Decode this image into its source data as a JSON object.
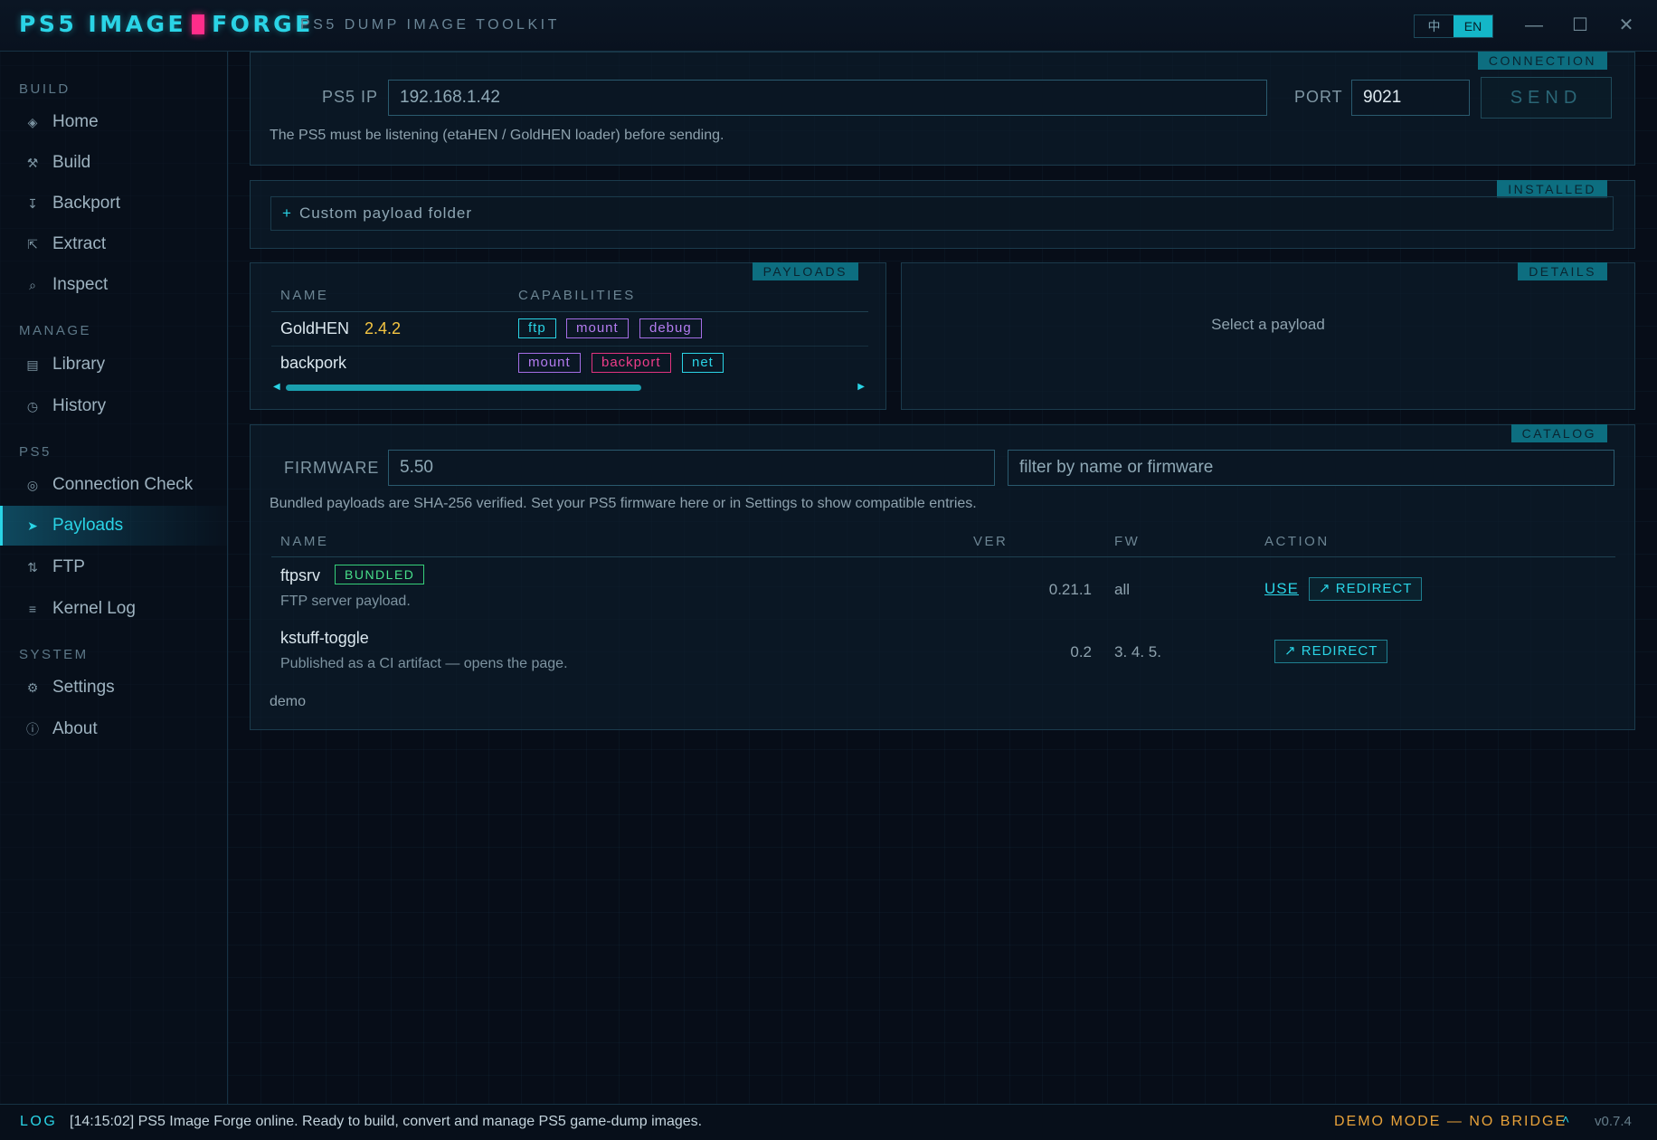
{
  "app": {
    "brand_left": "PS5 IMAGE",
    "brand_right": "FORGE",
    "subtitle": "PS5 DUMP IMAGE TOOLKIT",
    "lang_options": [
      "中",
      "EN"
    ],
    "active_lang": "EN",
    "window_controls": {
      "minimize": "—",
      "maximize": "☐",
      "close": "✕"
    }
  },
  "sidebar": {
    "sections": [
      {
        "label": "BUILD",
        "items": [
          {
            "icon": "home-icon",
            "glyph": "◈",
            "label": "Home"
          },
          {
            "icon": "build-icon",
            "glyph": "⚒",
            "label": "Build"
          },
          {
            "icon": "backport-icon",
            "glyph": "↧",
            "label": "Backport"
          },
          {
            "icon": "extract-icon",
            "glyph": "⇱",
            "label": "Extract"
          },
          {
            "icon": "inspect-icon",
            "glyph": "⌕",
            "label": "Inspect"
          }
        ]
      },
      {
        "label": "MANAGE",
        "items": [
          {
            "icon": "library-icon",
            "glyph": "▤",
            "label": "Library"
          },
          {
            "icon": "history-icon",
            "glyph": "◷",
            "label": "History"
          }
        ]
      },
      {
        "label": "PS5",
        "items": [
          {
            "icon": "connection-check-icon",
            "glyph": "◎",
            "label": "Connection Check"
          },
          {
            "icon": "payloads-icon",
            "glyph": "➤",
            "label": "Payloads",
            "active": true
          },
          {
            "icon": "ftp-icon",
            "glyph": "⇅",
            "label": "FTP"
          },
          {
            "icon": "kernel-log-icon",
            "glyph": "≡",
            "label": "Kernel Log"
          }
        ]
      },
      {
        "label": "SYSTEM",
        "items": [
          {
            "icon": "settings-icon",
            "glyph": "⚙",
            "label": "Settings"
          },
          {
            "icon": "about-icon",
            "glyph": "ⓘ",
            "label": "About"
          }
        ]
      }
    ]
  },
  "connection": {
    "tag": "CONNECTION",
    "ip_label": "PS5 IP",
    "ip_value": "192.168.1.42",
    "port_label": "PORT",
    "port_value": "9021",
    "send_label": "SEND",
    "hint": "The PS5 must be listening (etaHEN / GoldHEN loader) before sending."
  },
  "installed": {
    "tag": "INSTALLED",
    "add_folder_icon": "+",
    "add_folder_label": "Custom payload folder"
  },
  "payloads": {
    "tag": "PAYLOADS",
    "columns": [
      "NAME",
      "CAPABILITIES"
    ],
    "rows": [
      {
        "name": "GoldHEN",
        "version": "2.4.2",
        "caps": [
          "ftp",
          "mount",
          "debug"
        ]
      },
      {
        "name": "backpork",
        "version": "",
        "caps": [
          "mount",
          "backport",
          "net"
        ]
      }
    ]
  },
  "details": {
    "tag": "DETAILS",
    "placeholder": "Select a payload"
  },
  "catalog": {
    "tag": "CATALOG",
    "firmware_label": "FIRMWARE",
    "firmware_value": "5.50",
    "filter_placeholder": "filter by name or firmware",
    "hint": "Bundled payloads are SHA-256 verified. Set your PS5 firmware here or in Settings to show compatible entries.",
    "columns": [
      "NAME",
      "VER",
      "FW",
      "ACTION"
    ],
    "rows": [
      {
        "name": "ftpsrv",
        "badge": "BUNDLED",
        "desc": "FTP server payload.",
        "ver": "0.21.1",
        "fw": "all",
        "use_label": "USE",
        "redirect_label": "↗ REDIRECT"
      },
      {
        "name": "kstuff-toggle",
        "badge": "",
        "desc": "Published as a CI artifact — opens the page.",
        "ver": "0.2",
        "fw": "3. 4. 5.",
        "use_label": "",
        "redirect_label": "↗ REDIRECT"
      }
    ],
    "footer": "demo"
  },
  "statusbar": {
    "log_tag": "LOG",
    "message": "[14:15:02] PS5 Image Forge online. Ready to build, convert and manage PS5 game-dump images.",
    "demo_mode": "DEMO MODE — NO BRIDGE",
    "caret": "˄",
    "version": "v0.7.4"
  },
  "colors": {
    "accent": "#2ad4e6",
    "brand_pink": "#ff2d8a",
    "version_yellow": "#f4c542",
    "bundled_green": "#48e08a",
    "demo_orange": "#e8a23a",
    "cap_purple": "#b47cf0",
    "cap_pink": "#ef3d8a"
  }
}
